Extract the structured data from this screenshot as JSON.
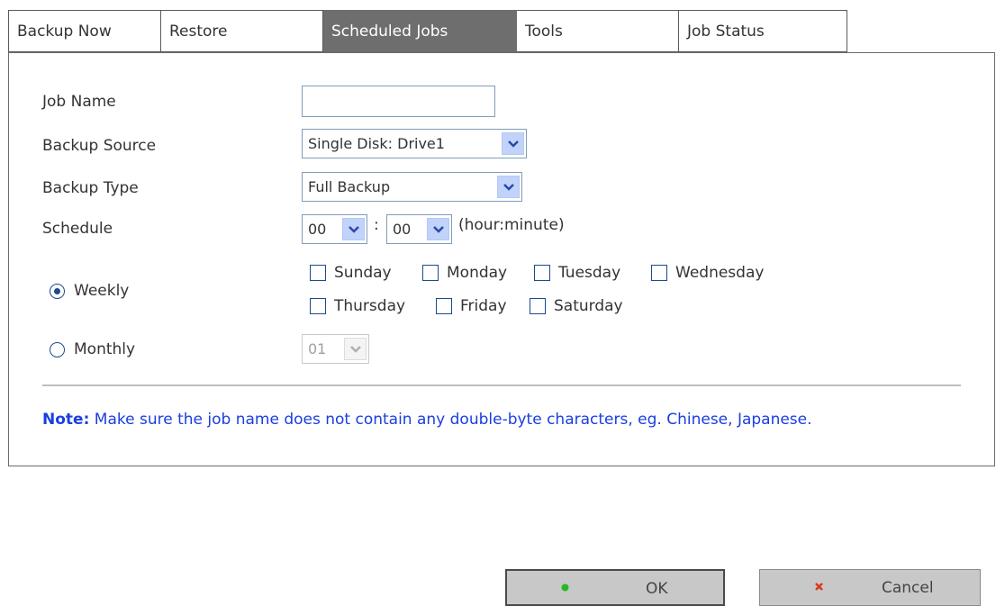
{
  "tabs": [
    {
      "label": "Backup Now",
      "active": false
    },
    {
      "label": "Restore",
      "active": false
    },
    {
      "label": "Scheduled Jobs",
      "active": true
    },
    {
      "label": "Tools",
      "active": false
    },
    {
      "label": "Job Status",
      "active": false
    }
  ],
  "form": {
    "job_name": {
      "label": "Job Name",
      "value": "",
      "placeholder": ""
    },
    "backup_source": {
      "label": "Backup Source",
      "selected": "Single Disk: Drive1"
    },
    "backup_type": {
      "label": "Backup Type",
      "selected": "Full Backup"
    },
    "schedule": {
      "label": "Schedule",
      "hour": "00",
      "separator": ":",
      "minute": "00",
      "hint": "(hour:minute)"
    },
    "weekly": {
      "label": "Weekly",
      "checked": true
    },
    "monthly": {
      "label": "Monthly",
      "checked": false,
      "day": "01"
    },
    "days": [
      "Sunday",
      "Monday",
      "Tuesday",
      "Wednesday",
      "Thursday",
      "Friday",
      "Saturday"
    ]
  },
  "note": {
    "prefix": "Note:",
    "text": "Make sure the job name does not contain any double-byte characters, eg. Chinese, Japanese."
  },
  "buttons": {
    "ok": {
      "label": "OK",
      "icon": "green-dot-icon",
      "icon_color": "#22bb22"
    },
    "cancel": {
      "label": "Cancel",
      "icon": "close-icon",
      "icon_color": "#d9381e"
    }
  },
  "colors": {
    "active_tab_bg": "#6e6e6e",
    "note_text": "#1a3ee0",
    "control_border": "#7f9db9",
    "dropdown_arrow_bg": "#c1d3fb"
  }
}
